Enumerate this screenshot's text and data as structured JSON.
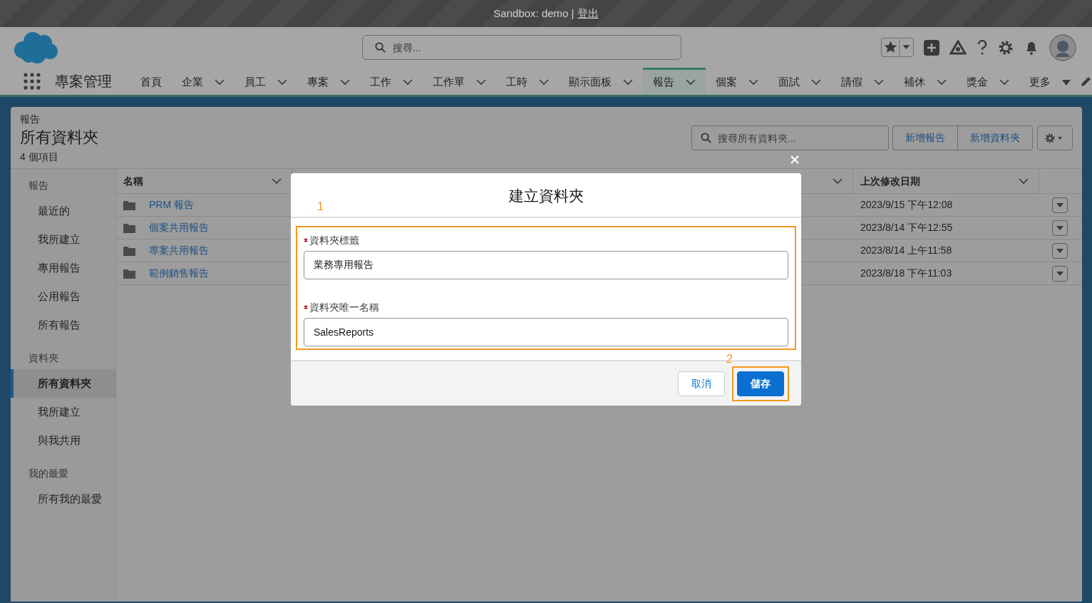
{
  "sandbox_bar": {
    "text": "Sandbox: demo | ",
    "logout": "登出"
  },
  "header": {
    "search": {
      "placeholder": "搜尋..."
    }
  },
  "nav": {
    "app_name": "專案管理",
    "items": [
      {
        "label": "首頁",
        "kind": "plain",
        "selected": false
      },
      {
        "label": "企業",
        "kind": "chevron",
        "selected": false
      },
      {
        "label": "員工",
        "kind": "chevron",
        "selected": false
      },
      {
        "label": "專案",
        "kind": "chevron",
        "selected": false
      },
      {
        "label": "工作",
        "kind": "chevron",
        "selected": false
      },
      {
        "label": "工作單",
        "kind": "chevron",
        "selected": false
      },
      {
        "label": "工時",
        "kind": "chevron",
        "selected": false
      },
      {
        "label": "顯示面板",
        "kind": "chevron",
        "selected": false
      },
      {
        "label": "報告",
        "kind": "chevron",
        "selected": true
      },
      {
        "label": "個案",
        "kind": "chevron",
        "selected": false
      },
      {
        "label": "面試",
        "kind": "chevron",
        "selected": false
      },
      {
        "label": "請假",
        "kind": "chevron",
        "selected": false
      },
      {
        "label": "補休",
        "kind": "chevron",
        "selected": false
      },
      {
        "label": "獎金",
        "kind": "chevron",
        "selected": false
      },
      {
        "label": "更多",
        "kind": "triangle",
        "selected": false
      }
    ]
  },
  "page_header": {
    "breadcrumb": "報告",
    "title": "所有資料夾",
    "count": "4 個項目",
    "search": {
      "placeholder": "搜尋所有資料夾..."
    },
    "buttons": [
      "新增報告",
      "新增資料夾"
    ]
  },
  "sidebar": {
    "sections": [
      {
        "heading": "報告",
        "items": [
          {
            "label": "最近的",
            "selected": false
          },
          {
            "label": "我所建立",
            "selected": false
          },
          {
            "label": "專用報告",
            "selected": false
          },
          {
            "label": "公用報告",
            "selected": false
          },
          {
            "label": "所有報告",
            "selected": false
          }
        ]
      },
      {
        "heading": "資料夾",
        "items": [
          {
            "label": "所有資料夾",
            "selected": true
          },
          {
            "label": "我所建立",
            "selected": false
          },
          {
            "label": "與我共用",
            "selected": false
          }
        ]
      },
      {
        "heading": "我的最愛",
        "items": [
          {
            "label": "所有我的最愛",
            "selected": false
          }
        ]
      }
    ]
  },
  "table": {
    "columns": [
      "名稱",
      "",
      "上次修改日期"
    ],
    "rows": [
      {
        "name": "PRM 報告",
        "modified": "2023/9/15 下午12:08"
      },
      {
        "name": "個案共用報告",
        "modified": "2023/8/14 下午12:55"
      },
      {
        "name": "專案共用報告",
        "modified": "2023/8/14 上午11:58"
      },
      {
        "name": "範例銷售報告",
        "modified": "2023/8/18 下午11:03"
      }
    ]
  },
  "modal": {
    "title": "建立資料夾",
    "fields": [
      {
        "label": "資料夾標籤",
        "required": true,
        "value": "業務專用報告"
      },
      {
        "label": "資料夾唯一名稱",
        "required": true,
        "value": "SalesReports"
      }
    ],
    "buttons": [
      {
        "label": "取消",
        "kind": "neutral"
      },
      {
        "label": "儲存",
        "kind": "brand"
      }
    ],
    "annotations": [
      "1",
      "2"
    ]
  }
}
